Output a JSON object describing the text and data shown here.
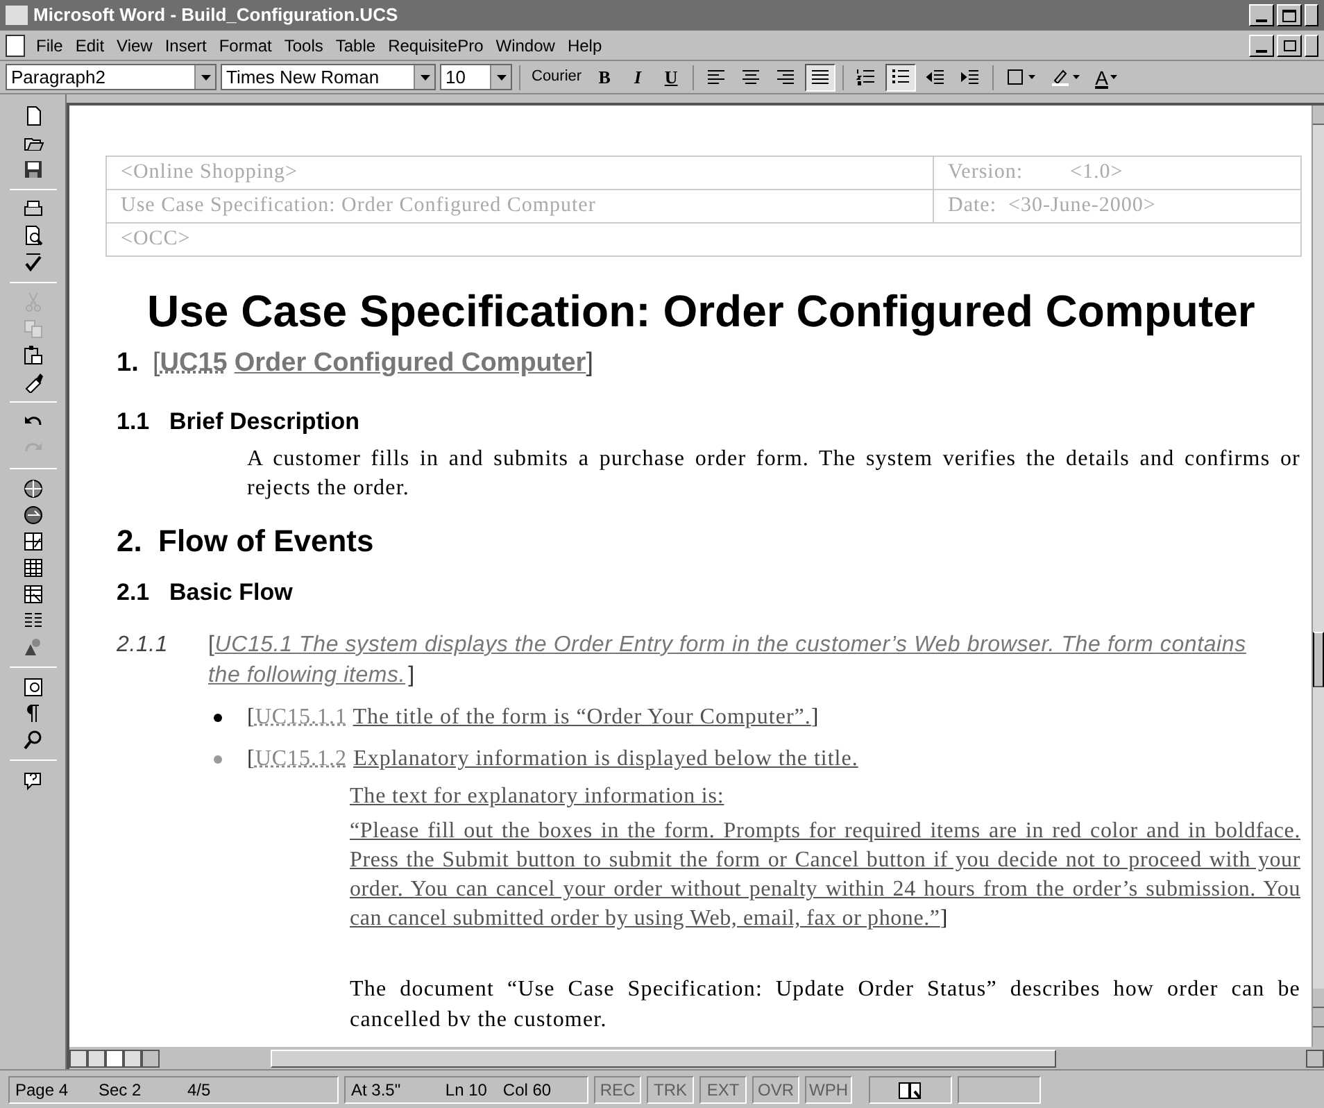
{
  "window": {
    "title": "Microsoft Word - Build_Configuration.UCS"
  },
  "menu": [
    "File",
    "Edit",
    "View",
    "Insert",
    "Format",
    "Tools",
    "Table",
    "RequisitePro",
    "Window",
    "Help"
  ],
  "formatting_toolbar": {
    "style": "Paragraph2",
    "font": "Times New Roman",
    "size": "10",
    "char_style": "Courier",
    "buttons": [
      {
        "kind": "bold",
        "label": "B",
        "selected": false
      },
      {
        "kind": "italic",
        "label": "I",
        "selected": false
      },
      {
        "kind": "underline",
        "label": "U",
        "selected": false
      },
      {
        "kind": "align-left",
        "selected": false
      },
      {
        "kind": "align-center",
        "selected": false
      },
      {
        "kind": "align-right",
        "selected": false
      },
      {
        "kind": "justify",
        "selected": true
      },
      {
        "kind": "numbering",
        "selected": false
      },
      {
        "kind": "bullets",
        "selected": true
      },
      {
        "kind": "outdent",
        "selected": false
      },
      {
        "kind": "indent",
        "selected": false
      },
      {
        "kind": "border",
        "selected": false
      },
      {
        "kind": "highlight",
        "selected": false
      },
      {
        "kind": "font-color",
        "label": "A",
        "selected": false
      }
    ]
  },
  "standard_toolbar": [
    {
      "kind": "new",
      "disabled": false
    },
    {
      "kind": "open",
      "disabled": false
    },
    {
      "kind": "save",
      "disabled": false
    },
    {
      "kind": "sep"
    },
    {
      "kind": "print",
      "disabled": false
    },
    {
      "kind": "preview",
      "disabled": false
    },
    {
      "kind": "spelling",
      "disabled": false
    },
    {
      "kind": "sep"
    },
    {
      "kind": "cut",
      "disabled": true
    },
    {
      "kind": "copy",
      "disabled": true
    },
    {
      "kind": "paste",
      "disabled": false
    },
    {
      "kind": "painter",
      "disabled": false
    },
    {
      "kind": "sep"
    },
    {
      "kind": "undo",
      "disabled": false
    },
    {
      "kind": "redo",
      "disabled": true
    },
    {
      "kind": "sep"
    },
    {
      "kind": "web",
      "disabled": false
    },
    {
      "kind": "web2",
      "disabled": false
    },
    {
      "kind": "tables",
      "disabled": false
    },
    {
      "kind": "table",
      "disabled": false
    },
    {
      "kind": "worksheet",
      "disabled": false
    },
    {
      "kind": "columns",
      "disabled": false
    },
    {
      "kind": "drawing",
      "disabled": false
    },
    {
      "kind": "sep"
    },
    {
      "kind": "map",
      "disabled": false
    },
    {
      "kind": "pilcrow",
      "disabled": false
    },
    {
      "kind": "zoom",
      "disabled": false
    },
    {
      "kind": "sep"
    },
    {
      "kind": "help",
      "disabled": false
    }
  ],
  "document": {
    "header_table": [
      [
        "<Online Shopping>",
        "Version:        <1.0>"
      ],
      [
        "Use Case Specification: Order Configured Computer",
        "Date:  <30-June-2000>"
      ],
      [
        "<OCC>"
      ]
    ],
    "title": "Use Case Specification: Order Configured Computer",
    "heading_1": {
      "number": "1.",
      "open": "[",
      "tag": "UC15",
      "text": "Order Configured Computer",
      "close": "]"
    },
    "heading_1_1": {
      "number": "1.1",
      "text": "Brief Description"
    },
    "brief": "A customer fills in and submits a purchase order form. The system verifies the details and confirms or rejects the order.",
    "heading_2": {
      "number": "2.",
      "text": "Flow of Events"
    },
    "heading_2_1": {
      "number": "2.1",
      "text": "Basic Flow"
    },
    "step": {
      "number": "2.1.1",
      "open": "[",
      "tag": "UC15.1",
      "text": "The system displays the Order Entry form in the customer’s Web browser. The form contains the following items.",
      "close": "]"
    },
    "items": [
      {
        "open": "[",
        "tag": "UC15.1.1",
        "text": "The title of the form is “Order Your Computer”.",
        "close": "]",
        "color": "#000000"
      },
      {
        "open": "[",
        "tag": "UC15.1.2",
        "text": "Explanatory information is displayed below the title.",
        "color": "#9a9a9a"
      }
    ],
    "explain_intro": "The text for explanatory information is:",
    "explain_quote": {
      "text": "“Please fill out the boxes in the form. Prompts for required items are in red color and in boldface. Press the Submit button to submit the form or Cancel button if you decide not to proceed with your order. You can cancel your order without penalty within 24 hours from the order’s submission. You can cancel submitted order by using Web, email, fax or phone.”",
      "close": "]"
    },
    "note": "The document “Use Case Specification: Update Order Status” describes how order can be cancelled bv the customer."
  },
  "status_bar": {
    "fields": [
      "Page 4",
      "Sec 2",
      "4/5",
      "At 3.5\"",
      "Ln 10",
      "Col 60"
    ],
    "modes": [
      {
        "label": "REC",
        "on": false
      },
      {
        "label": "TRK",
        "on": false
      },
      {
        "label": "EXT",
        "on": false
      },
      {
        "label": "OVR",
        "on": false
      },
      {
        "label": "WPH",
        "on": false
      }
    ]
  }
}
